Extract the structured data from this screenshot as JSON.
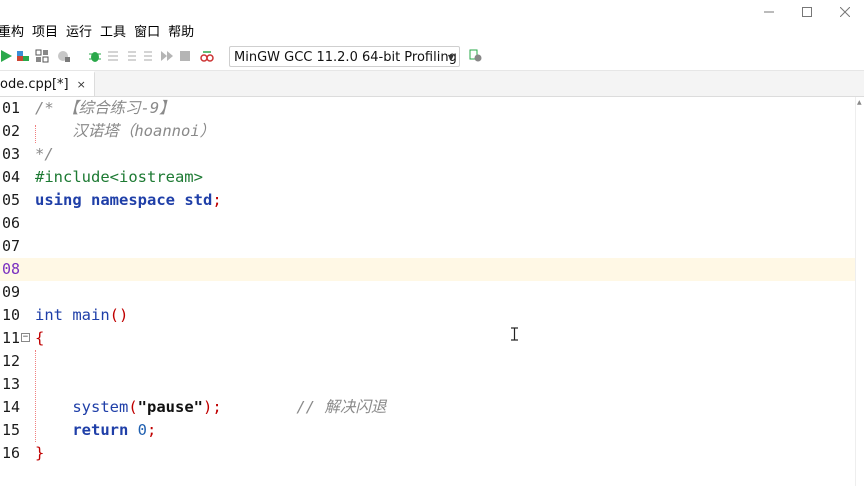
{
  "menubar": [
    "重构",
    "项目",
    "运行",
    "工具",
    "窗口",
    "帮助"
  ],
  "window_controls": [
    "minimize",
    "maximize",
    "close"
  ],
  "toolbar": {
    "icons": [
      "run-icon",
      "compile-run-icon",
      "rebuild-icon",
      "profile-icon",
      "debug-icon",
      "step-icon",
      "step-into-icon",
      "step-out-icon",
      "continue-icon",
      "stop-icon",
      "check-syntax-icon",
      "compiler-options-icon"
    ],
    "compiler": "MinGW GCC 11.2.0 64-bit Profiling"
  },
  "tab": {
    "label": "ode.cpp[*]",
    "close": "×"
  },
  "editor": {
    "current_line": "08",
    "line_numbers": [
      "01",
      "02",
      "03",
      "04",
      "05",
      "06",
      "07",
      "08",
      "09",
      "10",
      "11",
      "12",
      "13",
      "14",
      "15",
      "16"
    ]
  },
  "code": {
    "l01": "/* 【综合练习-9】",
    "l02": "    汉诺塔（hoannoi）",
    "l03": "*/",
    "l04_pre": "#include",
    "l04_hdr": "<iostream>",
    "l05_a": "using namespace",
    "l05_b": "std",
    "l05_c": ";",
    "l10_a": "int",
    "l10_b": "main",
    "l10_c": "()",
    "l11": "{",
    "l14_a": "system",
    "l14_b": "(",
    "l14_c": "\"pause\"",
    "l14_d": ");",
    "l14_e": "// 解决闪退",
    "l15_a": "return",
    "l15_b": "0",
    "l15_c": ";",
    "l16": "}"
  },
  "colors": {
    "keyword": "#1f3fa8",
    "preprocessor": "#1d7a33",
    "comment": "#8a8a8a",
    "brace": "#c00000",
    "current_line": "#fff8e5"
  }
}
